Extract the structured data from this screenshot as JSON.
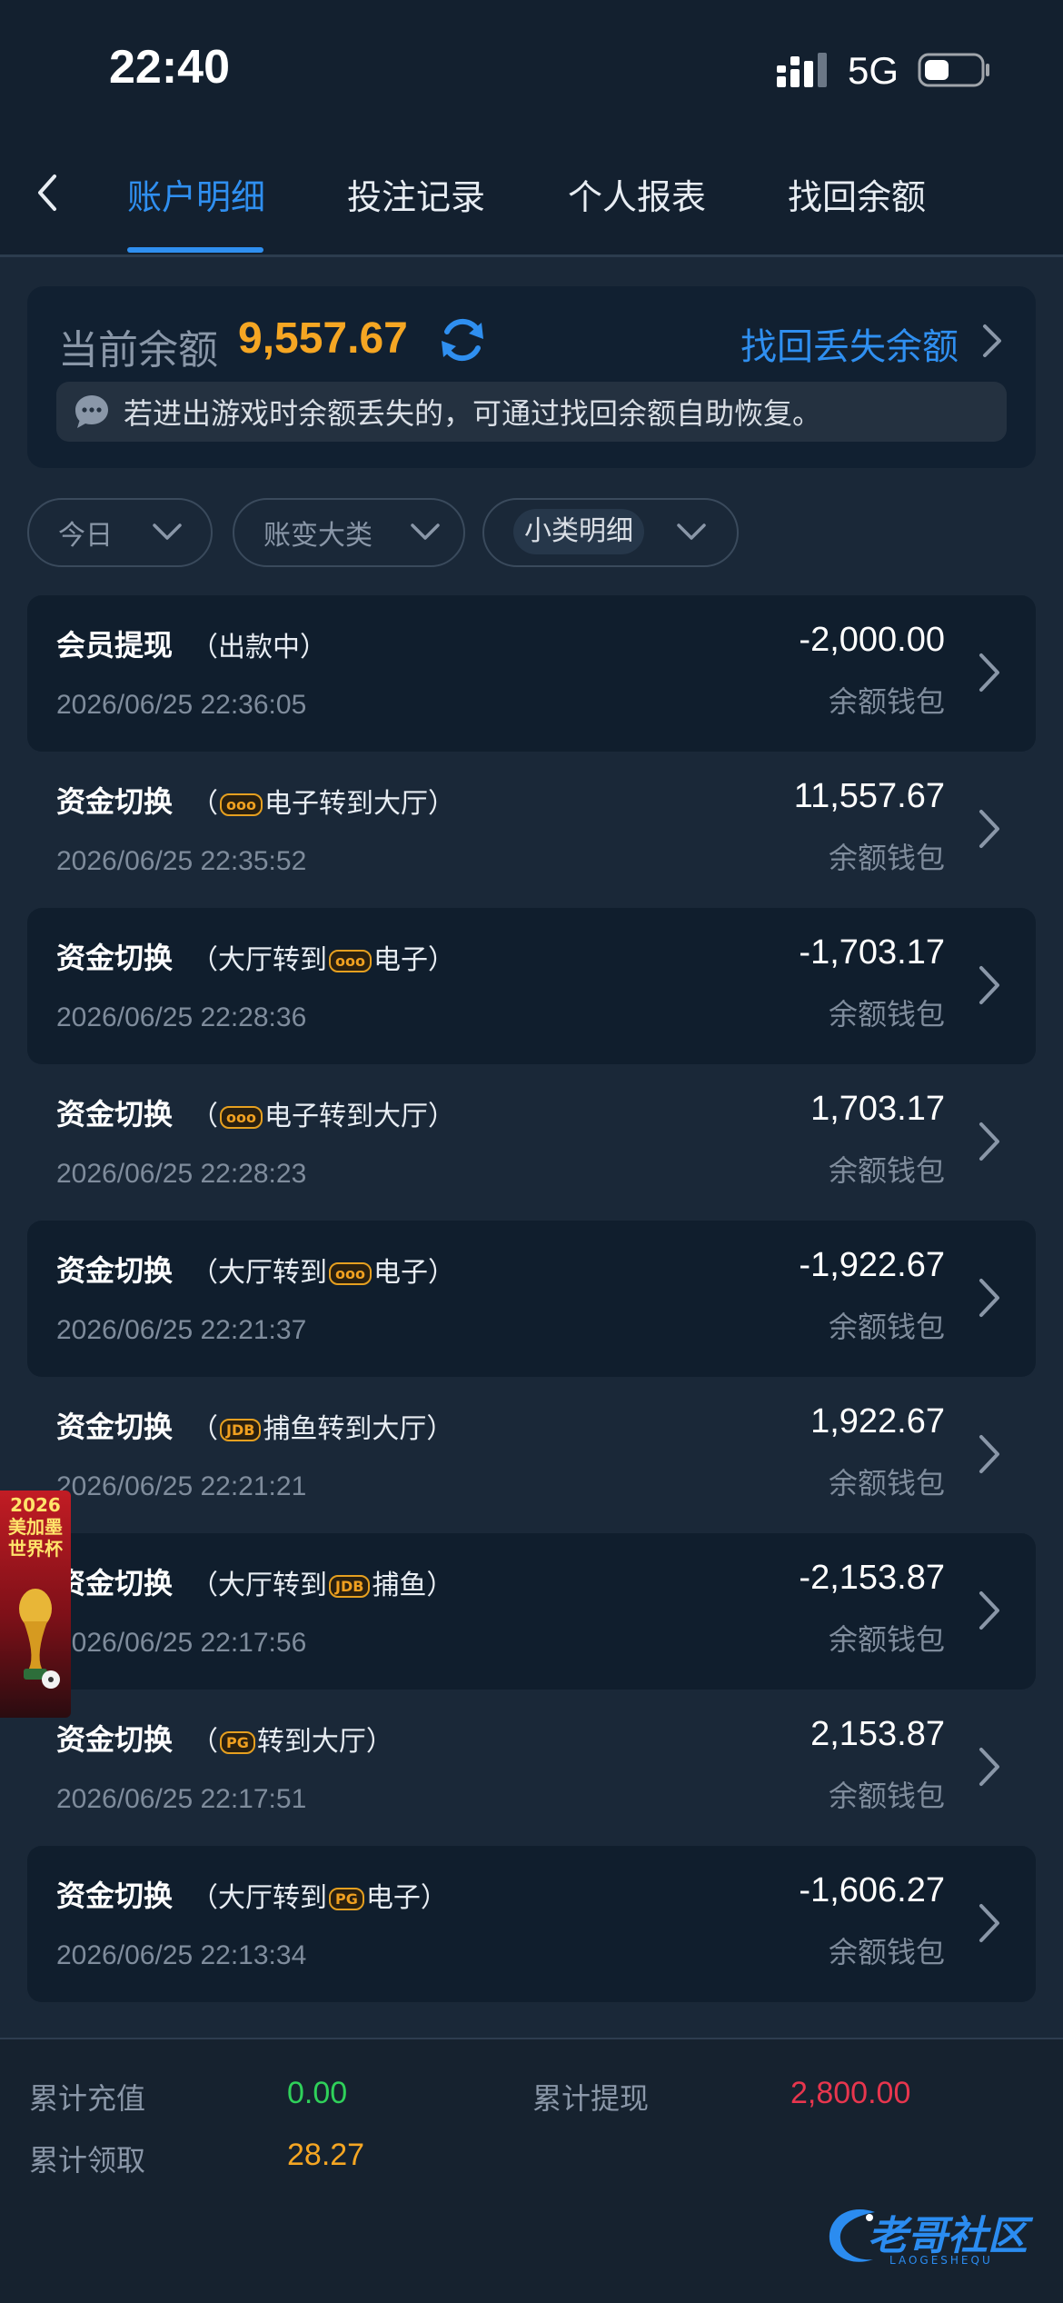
{
  "status_bar": {
    "time": "22:40",
    "network": "5G"
  },
  "nav": {
    "back_icon": "chevron-left-icon",
    "tabs": [
      {
        "label": "账户明细",
        "active": true
      },
      {
        "label": "投注记录",
        "active": false
      },
      {
        "label": "个人报表",
        "active": false
      },
      {
        "label": "找回余额",
        "active": false
      }
    ]
  },
  "balance": {
    "label": "当前余额",
    "value": "9,557.67",
    "recover_link": "找回丢失余额",
    "notice": "若进出游戏时余额丢失的，可通过找回余额自助恢复。"
  },
  "filters": [
    {
      "label": "今日"
    },
    {
      "label": "账变大类"
    },
    {
      "label": "小类明细"
    }
  ],
  "transactions": [
    {
      "title": "会员提现",
      "detail": "（出款中）",
      "time": "2026/06/25 22:36:05",
      "amount": "-2,000.00",
      "wallet": "余额钱包"
    },
    {
      "title": "资金切换",
      "detail_pre": "（",
      "badge": "ooo",
      "detail_post": "电子转到大厅）",
      "time": "2026/06/25 22:35:52",
      "amount": "11,557.67",
      "wallet": "余额钱包"
    },
    {
      "title": "资金切换",
      "detail_pre": "（大厅转到",
      "badge": "ooo",
      "detail_post": "电子）",
      "time": "2026/06/25 22:28:36",
      "amount": "-1,703.17",
      "wallet": "余额钱包"
    },
    {
      "title": "资金切换",
      "detail_pre": "（",
      "badge": "ooo",
      "detail_post": "电子转到大厅）",
      "time": "2026/06/25 22:28:23",
      "amount": "1,703.17",
      "wallet": "余额钱包"
    },
    {
      "title": "资金切换",
      "detail_pre": "（大厅转到",
      "badge": "ooo",
      "detail_post": "电子）",
      "time": "2026/06/25 22:21:37",
      "amount": "-1,922.67",
      "wallet": "余额钱包"
    },
    {
      "title": "资金切换",
      "detail_pre": "（",
      "badge": "JDB",
      "detail_post": "捕鱼转到大厅）",
      "time": "2026/06/25 22:21:21",
      "amount": "1,922.67",
      "wallet": "余额钱包"
    },
    {
      "title": "资金切换",
      "detail_pre": "（大厅转到",
      "badge": "JDB",
      "detail_post": "捕鱼）",
      "time": "2026/06/25 22:17:56",
      "amount": "-2,153.87",
      "wallet": "余额钱包"
    },
    {
      "title": "资金切换",
      "detail_pre": "（",
      "badge": "PG",
      "detail_post": "转到大厅）",
      "time": "2026/06/25 22:17:51",
      "amount": "2,153.87",
      "wallet": "余额钱包"
    },
    {
      "title": "资金切换",
      "detail_pre": "（大厅转到",
      "badge": "PG",
      "detail_post": "电子）",
      "time": "2026/06/25 22:13:34",
      "amount": "-1,606.27",
      "wallet": "余额钱包"
    }
  ],
  "promo": {
    "text_year": "2026",
    "text_line1": "美加墨",
    "text_line2": "世界杯"
  },
  "summary": {
    "deposit_label": "累计充值",
    "deposit_value": "0.00",
    "withdraw_label": "累计提现",
    "withdraw_value": "2,800.00",
    "claim_label": "累计领取",
    "claim_value": "28.27"
  },
  "watermark": {
    "text": "老哥社区",
    "sub": "LAOGESHEQU"
  },
  "colors": {
    "accent": "#2f8ff0",
    "balance": "#f5a623",
    "deposit": "#2fd15a",
    "withdraw": "#e8364e",
    "claim": "#f5a623"
  }
}
